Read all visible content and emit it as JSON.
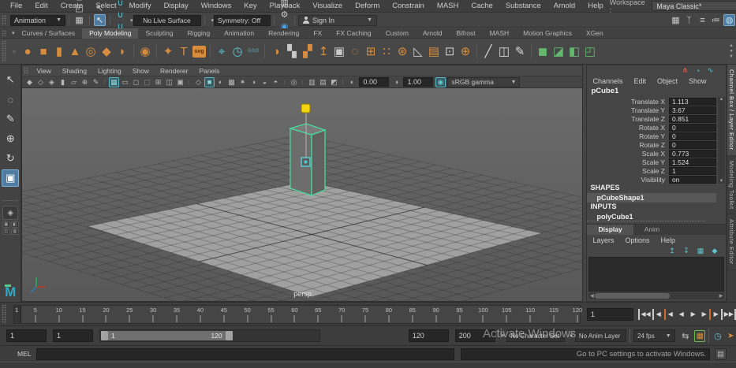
{
  "menu_bar": {
    "items": [
      "File",
      "Edit",
      "Create",
      "Select",
      "Modify",
      "Display",
      "Windows",
      "Key",
      "Playback",
      "Visualize",
      "Deform",
      "Constrain",
      "MASH",
      "Cache",
      "Substance",
      "Arnold",
      "Help"
    ],
    "workspace_label": "Workspace :",
    "workspace_value": "Maya Classic*"
  },
  "status_line": {
    "menuset": "Animation",
    "file_icons": [
      "new-scene-icon",
      "open-scene-icon",
      "save-scene-icon",
      "undo-icon",
      "redo-icon"
    ],
    "selection_icons": [
      "select-hierarchy-icon",
      "select-object-icon",
      "select-component-icon"
    ],
    "active_selection_icon": "select-object-icon",
    "snap_icons": [
      "snap-grid-icon",
      "snap-curve-icon",
      "snap-point-icon",
      "snap-projected-center-icon",
      "snap-view-plane-icon",
      "make-live-icon"
    ],
    "no_live_surface": "No Live Surface",
    "symmetry": "Symmetry: Off",
    "render_icons": [
      "render-view-icon",
      "render-current-frame-icon",
      "ipr-render-icon",
      "render-settings-icon",
      "hypershade-icon",
      "light-editor-icon",
      "paint-effects-icon",
      "pause-viewport-icon"
    ],
    "sign_in": "Sign In",
    "sidebar_icons": [
      "modeling-toolkit-icon",
      "humanik-icon",
      "attribute-editor-icon",
      "tool-settings-icon",
      "channel-box-icon"
    ],
    "active_sidebar_icon": "channel-box-icon"
  },
  "shelf": {
    "tabs": [
      "Curves / Surfaces",
      "Poly Modeling",
      "Sculpting",
      "Rigging",
      "Animation",
      "Rendering",
      "FX",
      "FX Caching",
      "Custom",
      "Arnold",
      "Bifrost",
      "MASH",
      "Motion Graphics",
      "XGen"
    ],
    "active_tab": "Poly Modeling",
    "icons": [
      "poly-sphere-icon",
      "poly-cube-icon",
      "poly-cylinder-icon",
      "poly-cone-icon",
      "poly-torus-icon",
      "poly-plane-icon",
      "poly-disc-icon",
      "|",
      "platonic-solid-icon",
      "|",
      "super-shape-icon",
      "poly-type-icon",
      "svg-import-icon",
      "|",
      "construction-plane-icon",
      "delete-history-icon",
      "zero-transforms-icon",
      "|",
      "smooth-mesh-icon",
      "combine-icon",
      "separate-icon",
      "extract-icon",
      "duplicate-face-icon",
      "smooth-icon",
      "mesh-cube-icon",
      "spread-faces-icon",
      "poly-wheel-icon",
      "triangulate-icon",
      "quad-mesh-icon",
      "lattice-deform-icon",
      "spherize-icon",
      "|",
      "multi-cut-icon",
      "insert-edge-loop-icon",
      "quad-draw-icon",
      "|",
      "boolean-union-icon",
      "boolean-difference-icon",
      "boolean-intersection-icon",
      "boolean-slice-icon"
    ]
  },
  "toolbox": {
    "tools": [
      "select-tool-icon",
      "lasso-tool-icon",
      "paint-select-tool-icon",
      "move-tool-icon",
      "rotate-tool-icon",
      "scale-tool-icon"
    ],
    "active_tool": "scale-tool-icon"
  },
  "panel_menu": {
    "items": [
      "View",
      "Shading",
      "Lighting",
      "Show",
      "Renderer",
      "Panels"
    ]
  },
  "viewport": {
    "toolbar_icons": [
      "viewport-camera-icon",
      "camera-lock-icon",
      "camera-settings-icon",
      "bookmark-icon",
      "image-plane-icon",
      "2d-pan-zoom-icon",
      "grease-pencil-icon",
      "|",
      "grid-toggle-icon",
      "film-gate-icon",
      "resolution-gate-icon",
      "gate-mask-icon",
      "field-chart-icon",
      "safe-action-icon",
      "safe-title-icon",
      "|",
      "wireframe-icon",
      "smooth-shade-icon",
      "wireframe-on-shaded-icon",
      "textured-icon",
      "use-all-lights-icon",
      "shadows-icon",
      "screen-space-ao-icon",
      "motion-blur-icon",
      "|",
      "isolate-select-icon",
      "|",
      "xray-icon",
      "xray-joints-icon",
      "selection-highlight-icon",
      "|",
      "exposure-icon"
    ],
    "active_icons": [
      "grid-toggle-icon",
      "smooth-shade-icon",
      "color-management-icon"
    ],
    "exposure": "0.00",
    "contrast_icon": "contrast-icon",
    "gamma": "1.00",
    "color_management_icon": "color-management-icon",
    "color_space": "sRGB gamma",
    "camera_label": "persp"
  },
  "channel_box": {
    "top_icons": [
      "channel-manip-icon",
      "channel-speed-icon",
      "channel-graph-icon"
    ],
    "menus": [
      "Channels",
      "Edit",
      "Object",
      "Show"
    ],
    "node_name": "pCube1",
    "attributes": [
      {
        "label": "Translate X",
        "value": "1.113"
      },
      {
        "label": "Translate Y",
        "value": "3.67"
      },
      {
        "label": "Translate Z",
        "value": "0.851"
      },
      {
        "label": "Rotate X",
        "value": "0"
      },
      {
        "label": "Rotate Y",
        "value": "0"
      },
      {
        "label": "Rotate Z",
        "value": "0"
      },
      {
        "label": "Scale X",
        "value": "0.773"
      },
      {
        "label": "Scale Y",
        "value": "1.524"
      },
      {
        "label": "Scale Z",
        "value": "1"
      },
      {
        "label": "Visibility",
        "value": "on"
      }
    ],
    "shapes_header": "SHAPES",
    "shape_name": "pCubeShape1",
    "inputs_header": "INPUTS",
    "input_name": "polyCube1"
  },
  "layer_editor": {
    "tabs": [
      "Display",
      "Anim"
    ],
    "active_tab": "Display",
    "menus": [
      "Layers",
      "Options",
      "Help"
    ],
    "icons": [
      "layer-move-up-icon",
      "layer-move-down-icon",
      "new-empty-layer-icon",
      "new-layer-from-selected-icon"
    ]
  },
  "side_tabs": {
    "items": [
      "Channel Box / Layer Editor",
      "Modeling Toolkit",
      "Attribute Editor"
    ],
    "active": "Channel Box / Layer Editor"
  },
  "time_slider": {
    "current_frame": "1",
    "tick_start": 5,
    "tick_end": 120,
    "tick_step": 5,
    "frame_min": 1,
    "frame_max": 120
  },
  "playback": {
    "current_frame_field": "1",
    "buttons": [
      "go-to-start-button",
      "step-back-frame-button",
      "step-back-key-button",
      "play-backwards-button",
      "play-forwards-button",
      "step-forward-key-button",
      "step-forward-frame-button",
      "go-to-end-button"
    ]
  },
  "range_slider": {
    "animation_start": "1",
    "playback_start": "1",
    "range_label_start": "1",
    "range_label_end": "120",
    "playback_end": "120",
    "animation_end": "200",
    "playback_fraction": 0.6,
    "character_set": "No Character Set",
    "anim_layer": "No Anim Layer",
    "fps": "24 fps",
    "extra_icons": [
      "playback-loop-icon",
      "animation-preferences-icon",
      "time-editor-icon",
      "evaluation-mode-icon"
    ]
  },
  "command_line": {
    "label": "MEL",
    "input_value": ""
  },
  "watermark": {
    "line1": "Activate Windows",
    "line2": "Go to PC settings to activate Windows."
  },
  "colors": {
    "accent_orange": "#d78d3d",
    "accent_teal": "#5ec6d0",
    "accent_green": "#63b86e",
    "selection_blue": "#4f7ca0",
    "wire_green": "#45e0a0",
    "manip_yellow": "#f5d411"
  }
}
